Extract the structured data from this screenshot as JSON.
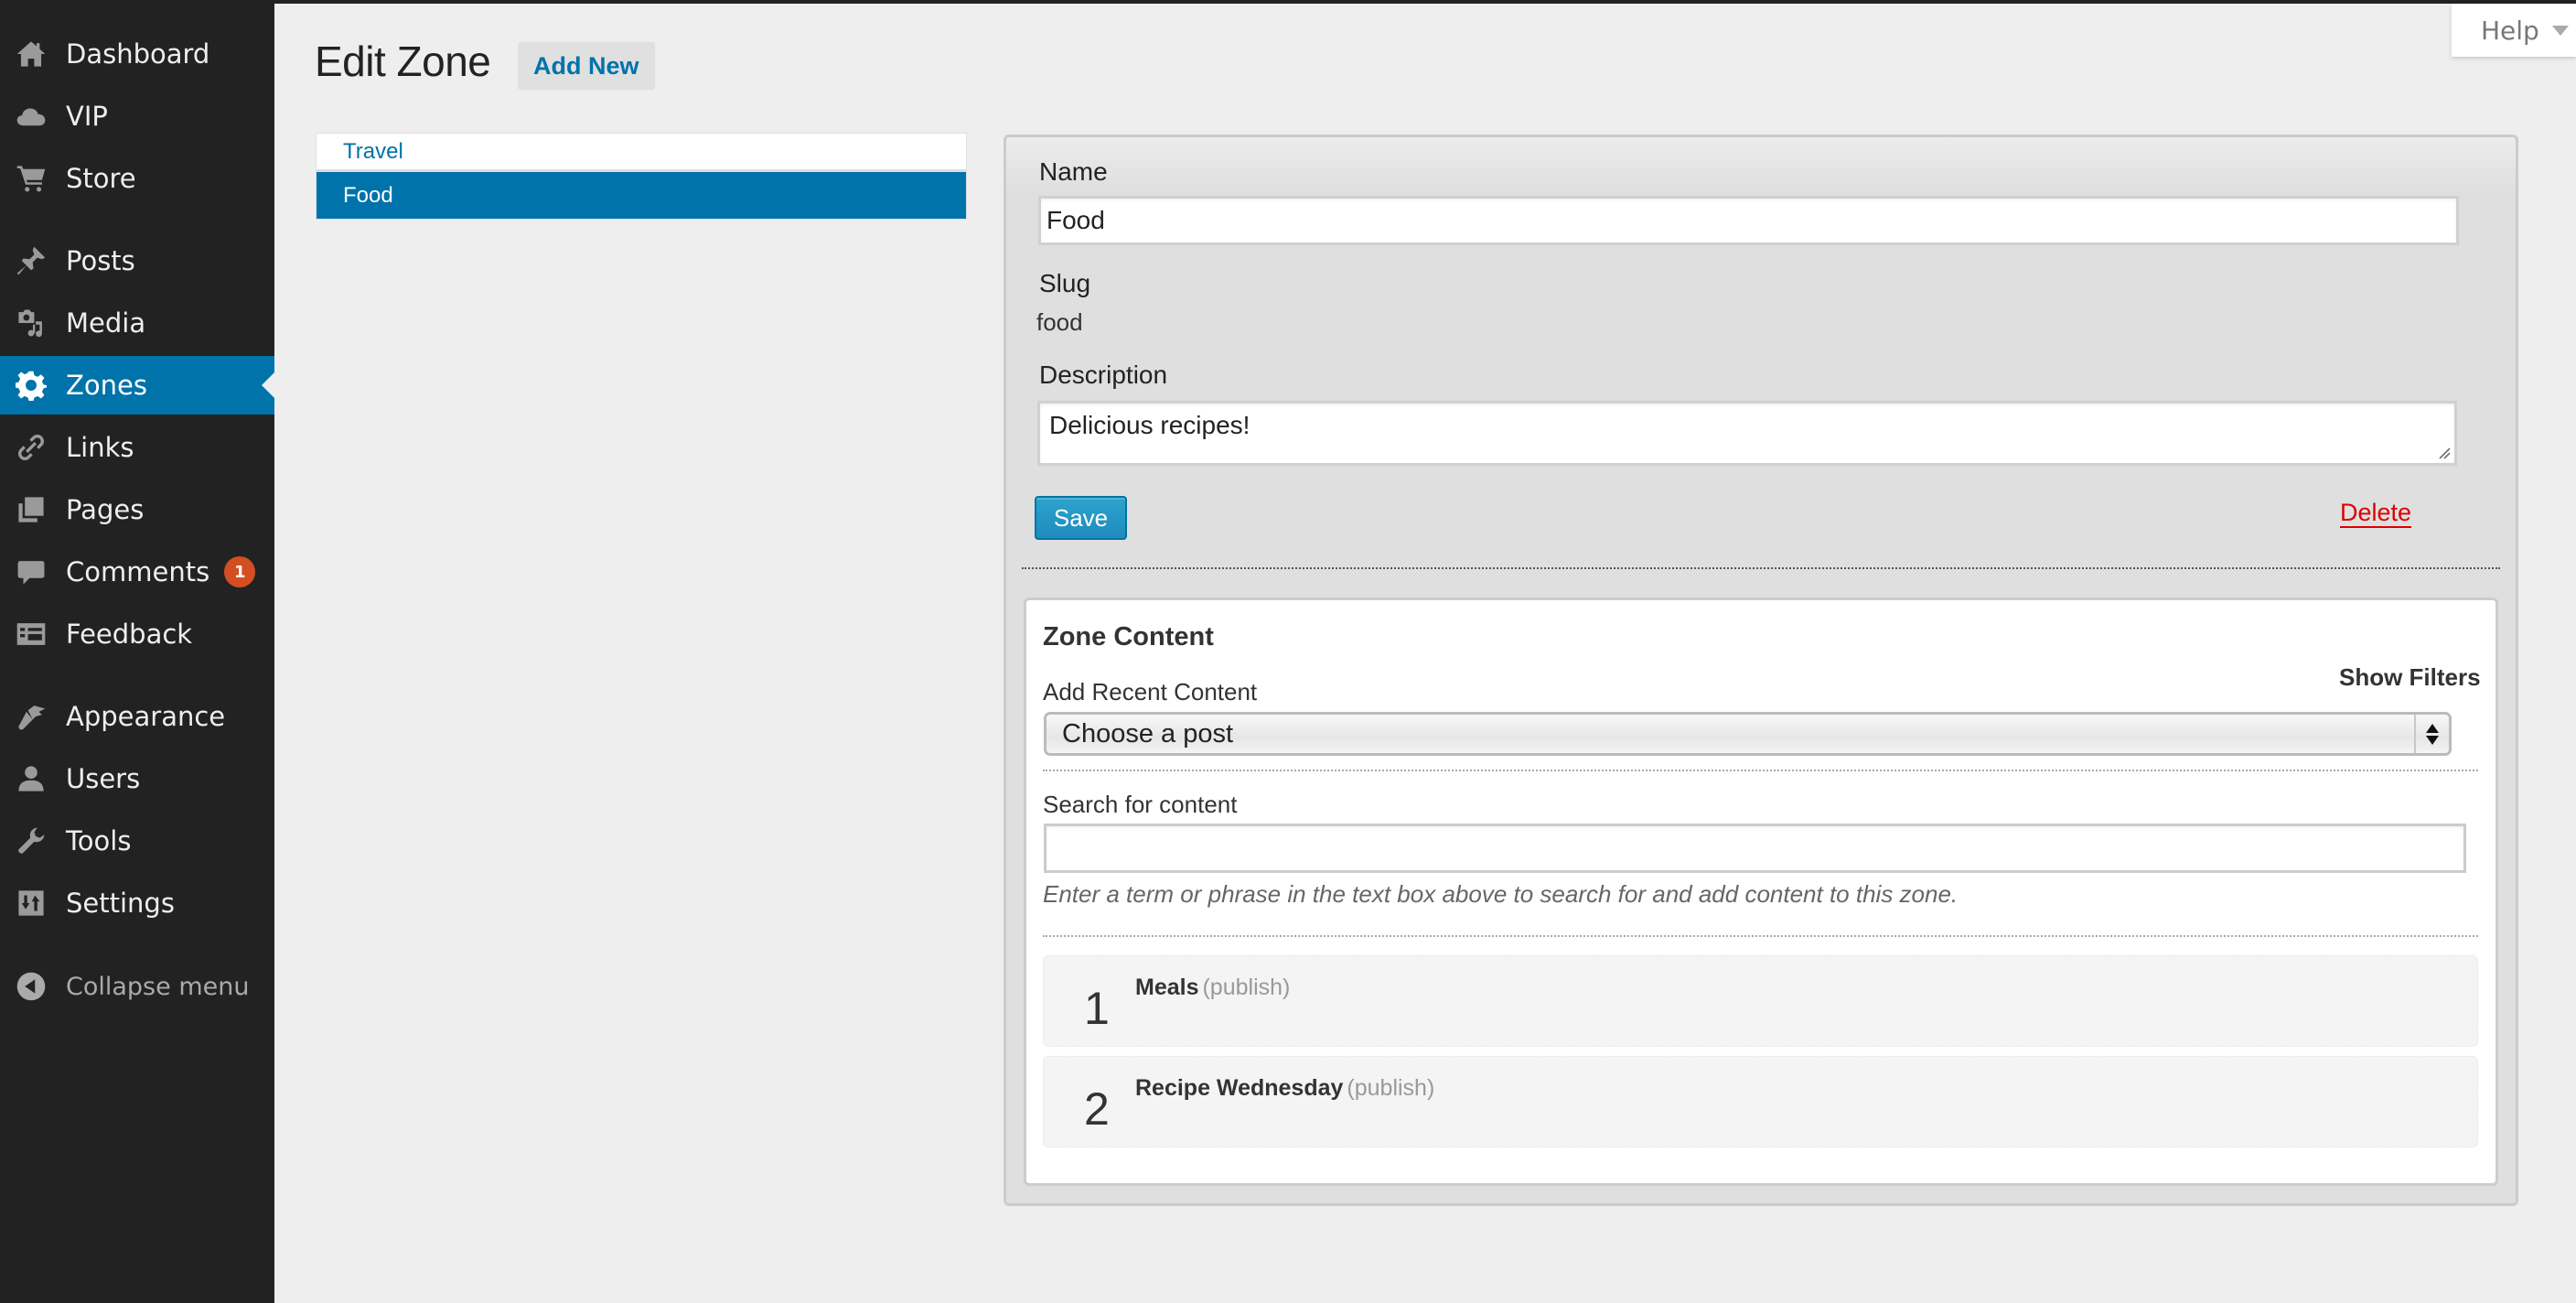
{
  "sidebar": {
    "items": [
      {
        "label": "Dashboard",
        "icon": "home-icon"
      },
      {
        "label": "VIP",
        "icon": "cloud-icon"
      },
      {
        "label": "Store",
        "icon": "cart-icon"
      },
      {
        "label": "Posts",
        "icon": "pushpin-icon"
      },
      {
        "label": "Media",
        "icon": "media-icon"
      },
      {
        "label": "Zones",
        "icon": "gear-icon",
        "active": true
      },
      {
        "label": "Links",
        "icon": "link-icon"
      },
      {
        "label": "Pages",
        "icon": "pages-icon"
      },
      {
        "label": "Comments",
        "icon": "comment-icon",
        "badge": "1"
      },
      {
        "label": "Feedback",
        "icon": "feedback-icon"
      },
      {
        "label": "Appearance",
        "icon": "paintbrush-icon"
      },
      {
        "label": "Users",
        "icon": "user-icon"
      },
      {
        "label": "Tools",
        "icon": "wrench-icon"
      },
      {
        "label": "Settings",
        "icon": "settings-sliders-icon"
      }
    ],
    "collapse_label": "Collapse menu"
  },
  "help": {
    "label": "Help"
  },
  "header": {
    "title": "Edit Zone",
    "add_new_label": "Add New"
  },
  "zones": [
    {
      "label": "Travel",
      "active": false
    },
    {
      "label": "Food",
      "active": true
    }
  ],
  "form": {
    "name_label": "Name",
    "name_value": "Food",
    "slug_label": "Slug",
    "slug_value": "food",
    "description_label": "Description",
    "description_value": "Delicious recipes!",
    "save_label": "Save",
    "delete_label": "Delete"
  },
  "zone_content": {
    "title": "Zone Content",
    "show_filters_label": "Show Filters",
    "add_recent_label": "Add Recent Content",
    "select_value": "Choose a post",
    "search_label": "Search for content",
    "search_value": "",
    "search_hint": "Enter a term or phrase in the text box above to search for and add content to this zone.",
    "posts": [
      {
        "number": "1",
        "title": "Meals",
        "status": "(publish)"
      },
      {
        "number": "2",
        "title": "Recipe Wednesday",
        "status": "(publish)"
      }
    ]
  },
  "colors": {
    "sidebar_bg": "#222222",
    "accent": "#0073aa",
    "badge": "#d54e21",
    "delete": "#dd0000",
    "primary_button": "#1e8cbe"
  }
}
